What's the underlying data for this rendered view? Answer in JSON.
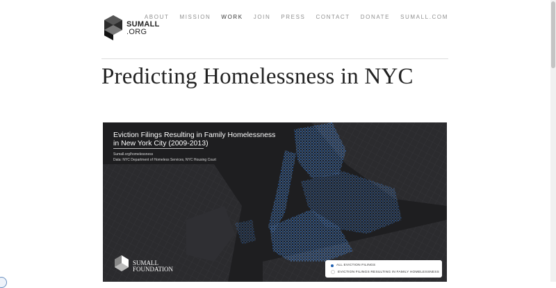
{
  "logo": {
    "line1": "SUMALL",
    "line2": ".ORG"
  },
  "nav": {
    "items": [
      {
        "label": "ABOUT",
        "active": false
      },
      {
        "label": "MISSION",
        "active": false
      },
      {
        "label": "WORK",
        "active": true
      },
      {
        "label": "JOIN",
        "active": false
      },
      {
        "label": "PRESS",
        "active": false
      },
      {
        "label": "CONTACT",
        "active": false
      },
      {
        "label": "DONATE",
        "active": false
      },
      {
        "label": "SUMALL.COM",
        "active": false
      }
    ]
  },
  "page": {
    "title": "Predicting Homelessness in NYC"
  },
  "map": {
    "title": "Eviction Filings Resulting in Family Homelessness in New York City (2009-2013)",
    "url": "Sumall.org/homelessness",
    "source": "Data: NYC Department of Homeless Services, NYC Housing Court",
    "foundation": {
      "line1": "SUMALL",
      "line2": "FOUNDATION"
    },
    "legend": [
      {
        "label": "ALL EVICTION FILINGS",
        "color": "#1f5fb0"
      },
      {
        "label": "EVICTION FILINGS RESULTING IN FAMILY HOMELESSNESS",
        "color": "#ffffff"
      }
    ],
    "colors": {
      "background": "#1e1e20",
      "land": "#2b2b2e",
      "dots": "#2f78d6",
      "highlight": "#cfe2ff"
    }
  }
}
